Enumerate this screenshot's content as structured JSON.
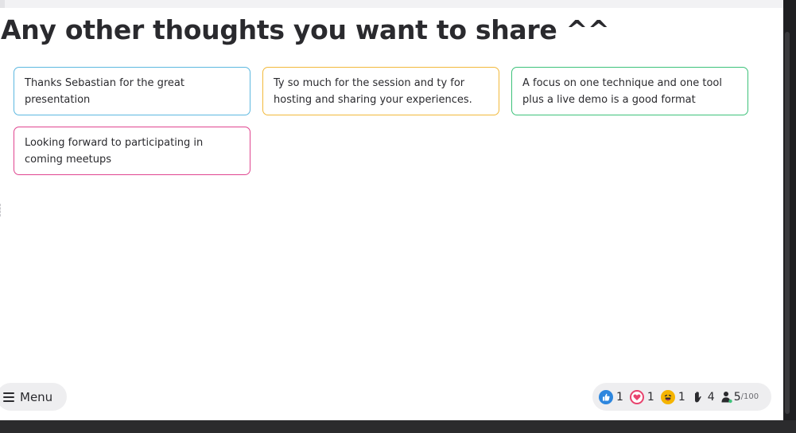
{
  "question": {
    "title": "Any other thoughts you want to share ^^"
  },
  "responses": [
    {
      "text": "Thanks Sebastian for the great presentation",
      "color": "#5db8e0"
    },
    {
      "text": "Ty so much for the session and ty for hosting and sharing your experiences.",
      "color": "#f2b93b"
    },
    {
      "text": "A focus on one technique and one tool plus a live demo is a good format",
      "color": "#3dc27a"
    },
    {
      "text": "Looking forward to participating in coming meetups",
      "color": "#e0458f"
    }
  ],
  "menu": {
    "label": "Menu",
    "icon": "hamburger-icon"
  },
  "reactions": [
    {
      "icon": "thumbs-up-icon",
      "count": "1",
      "color": "#2d86de"
    },
    {
      "icon": "heart-icon",
      "count": "1",
      "color": "#e8436e"
    },
    {
      "icon": "laugh-icon",
      "count": "1",
      "color": "#f5b400"
    },
    {
      "icon": "raised-hand-icon",
      "count": "4",
      "color": "#2a2a2e"
    }
  ],
  "participants": {
    "icon": "person-icon",
    "count": "5",
    "max": "/100"
  }
}
